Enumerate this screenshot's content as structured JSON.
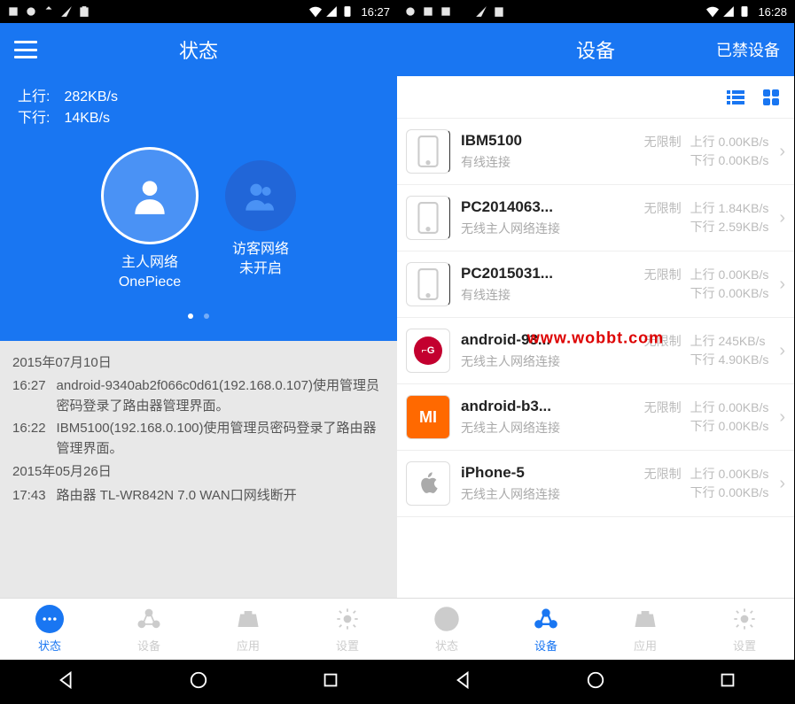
{
  "watermark": "www.wobbt.com",
  "left": {
    "status_time": "16:27",
    "header_title": "状态",
    "speed": {
      "up_label": "上行:",
      "up_value": "282KB/s",
      "down_label": "下行:",
      "down_value": "14KB/s"
    },
    "networks": {
      "main_label": "主人网络",
      "main_name": "OnePiece",
      "guest_label": "访客网络",
      "guest_status": "未开启"
    },
    "logs": [
      {
        "date": "2015年07月10日"
      },
      {
        "time": "16:27",
        "msg": "android-9340ab2f066c0d61(192.168.0.107)使用管理员密码登录了路由器管理界面。"
      },
      {
        "time": "16:22",
        "msg": "IBM5100(192.168.0.100)使用管理员密码登录了路由器管理界面。"
      },
      {
        "date": "2015年05月26日"
      },
      {
        "time": "17:43",
        "msg": "路由器 TL-WR842N 7.0 WAN口网线断开"
      }
    ],
    "tabs": {
      "status": "状态",
      "devices": "设备",
      "apps": "应用",
      "settings": "设置"
    }
  },
  "right": {
    "status_time": "16:28",
    "header_title": "设备",
    "header_action": "已禁设备",
    "devices": [
      {
        "name": "IBM5100",
        "conn": "有线连接",
        "limit": "无限制",
        "up": "上行 0.00KB/s",
        "down": "下行 0.00KB/s",
        "icon": "phone"
      },
      {
        "name": "PC2014063...",
        "conn": "无线主人网络连接",
        "limit": "无限制",
        "up": "上行 1.84KB/s",
        "down": "下行 2.59KB/s",
        "icon": "phone"
      },
      {
        "name": "PC2015031...",
        "conn": "有线连接",
        "limit": "无限制",
        "up": "上行 0.00KB/s",
        "down": "下行 0.00KB/s",
        "icon": "phone"
      },
      {
        "name": "android-93...",
        "conn": "无线主人网络连接",
        "limit": "无限制",
        "up": "上行 245KB/s",
        "down": "下行 4.90KB/s",
        "icon": "lg"
      },
      {
        "name": "android-b3...",
        "conn": "无线主人网络连接",
        "limit": "无限制",
        "up": "上行 0.00KB/s",
        "down": "下行 0.00KB/s",
        "icon": "mi"
      },
      {
        "name": "iPhone-5",
        "conn": "无线主人网络连接",
        "limit": "无限制",
        "up": "上行 0.00KB/s",
        "down": "下行 0.00KB/s",
        "icon": "apple"
      }
    ],
    "tabs": {
      "status": "状态",
      "devices": "设备",
      "apps": "应用",
      "settings": "设置"
    }
  }
}
